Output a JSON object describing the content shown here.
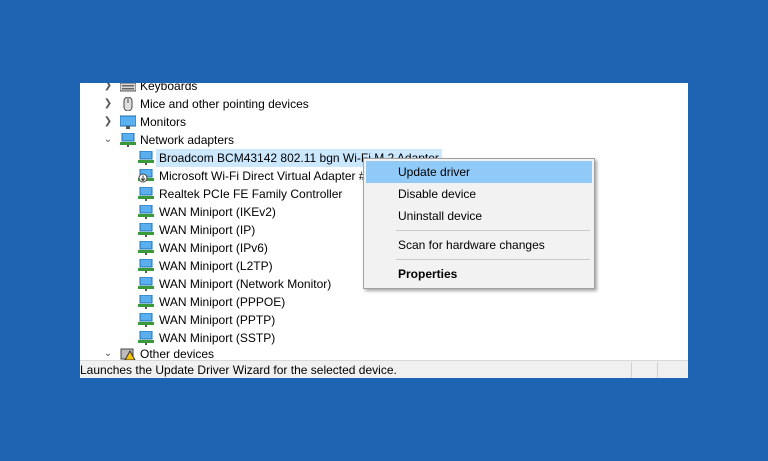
{
  "tree": {
    "categories": [
      {
        "label": "Keyboards",
        "icon": "keyboard-icon",
        "expanded": false
      },
      {
        "label": "Mice and other pointing devices",
        "icon": "mouse-icon",
        "expanded": false
      },
      {
        "label": "Monitors",
        "icon": "monitor-icon",
        "expanded": false
      },
      {
        "label": "Network adapters",
        "icon": "network-adapter-icon",
        "expanded": true
      },
      {
        "label": "Other devices",
        "icon": "warning-device-icon",
        "expanded": true
      }
    ],
    "network_adapters": [
      {
        "label": "Broadcom BCM43142 802.11 bgn Wi-Fi M.2 Adapter",
        "selected": true
      },
      {
        "label": "Microsoft Wi-Fi Direct Virtual Adapter #2"
      },
      {
        "label": "Realtek PCIe FE Family Controller"
      },
      {
        "label": "WAN Miniport (IKEv2)"
      },
      {
        "label": "WAN Miniport (IP)"
      },
      {
        "label": "WAN Miniport (IPv6)"
      },
      {
        "label": "WAN Miniport (L2TP)"
      },
      {
        "label": "WAN Miniport (Network Monitor)"
      },
      {
        "label": "WAN Miniport (PPPOE)"
      },
      {
        "label": "WAN Miniport (PPTP)"
      },
      {
        "label": "WAN Miniport (SSTP)"
      }
    ]
  },
  "context_menu": {
    "update_driver": "Update driver",
    "disable_device": "Disable device",
    "uninstall_device": "Uninstall device",
    "scan_hardware": "Scan for hardware changes",
    "properties": "Properties"
  },
  "status_bar": {
    "text": "Launches the Update Driver Wizard for the selected device."
  },
  "colors": {
    "background": "#1f63b3",
    "selection": "#cce8ff",
    "menu_highlight": "#91c9f7"
  }
}
